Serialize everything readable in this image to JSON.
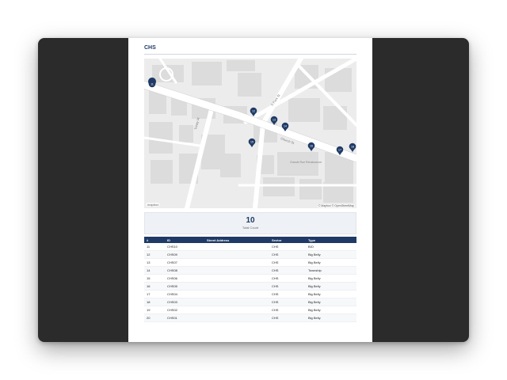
{
  "page": {
    "title": "CHS"
  },
  "map": {
    "streets": [
      "Church St",
      "S Park St",
      "Trinity Pl"
    ],
    "area_label": "Grande Rue Renaissance",
    "logo": "mapbox",
    "attribution": "© Mapbox © OpenStreetMap",
    "markers": [
      "11",
      "12",
      "13",
      "14",
      "15",
      "16",
      "17",
      "18",
      "19",
      "20"
    ]
  },
  "summary": {
    "count": "10",
    "label": "Total Count"
  },
  "table": {
    "headers": [
      "#",
      "ID",
      "Street Address",
      "Sector",
      "Type"
    ],
    "rows": [
      [
        "11",
        "CHS10",
        "",
        "CHS",
        "BIO"
      ],
      [
        "12",
        "CHS09",
        "",
        "CHS",
        "Big Belly"
      ],
      [
        "13",
        "CHS07",
        "",
        "CHS",
        "Big Belly"
      ],
      [
        "14",
        "CHS08",
        "",
        "CHS",
        "Township"
      ],
      [
        "15",
        "CHS06",
        "",
        "CHS",
        "Big Belly"
      ],
      [
        "16",
        "CHS05",
        "",
        "CHS",
        "Big Belly"
      ],
      [
        "17",
        "CHS04",
        "",
        "CHS",
        "Big Belly"
      ],
      [
        "18",
        "CHS03",
        "",
        "CHS",
        "Big Belly"
      ],
      [
        "19",
        "CHS02",
        "",
        "CHS",
        "Big Belly"
      ],
      [
        "20",
        "CHS01",
        "",
        "CHS",
        "Big Belly"
      ]
    ]
  }
}
